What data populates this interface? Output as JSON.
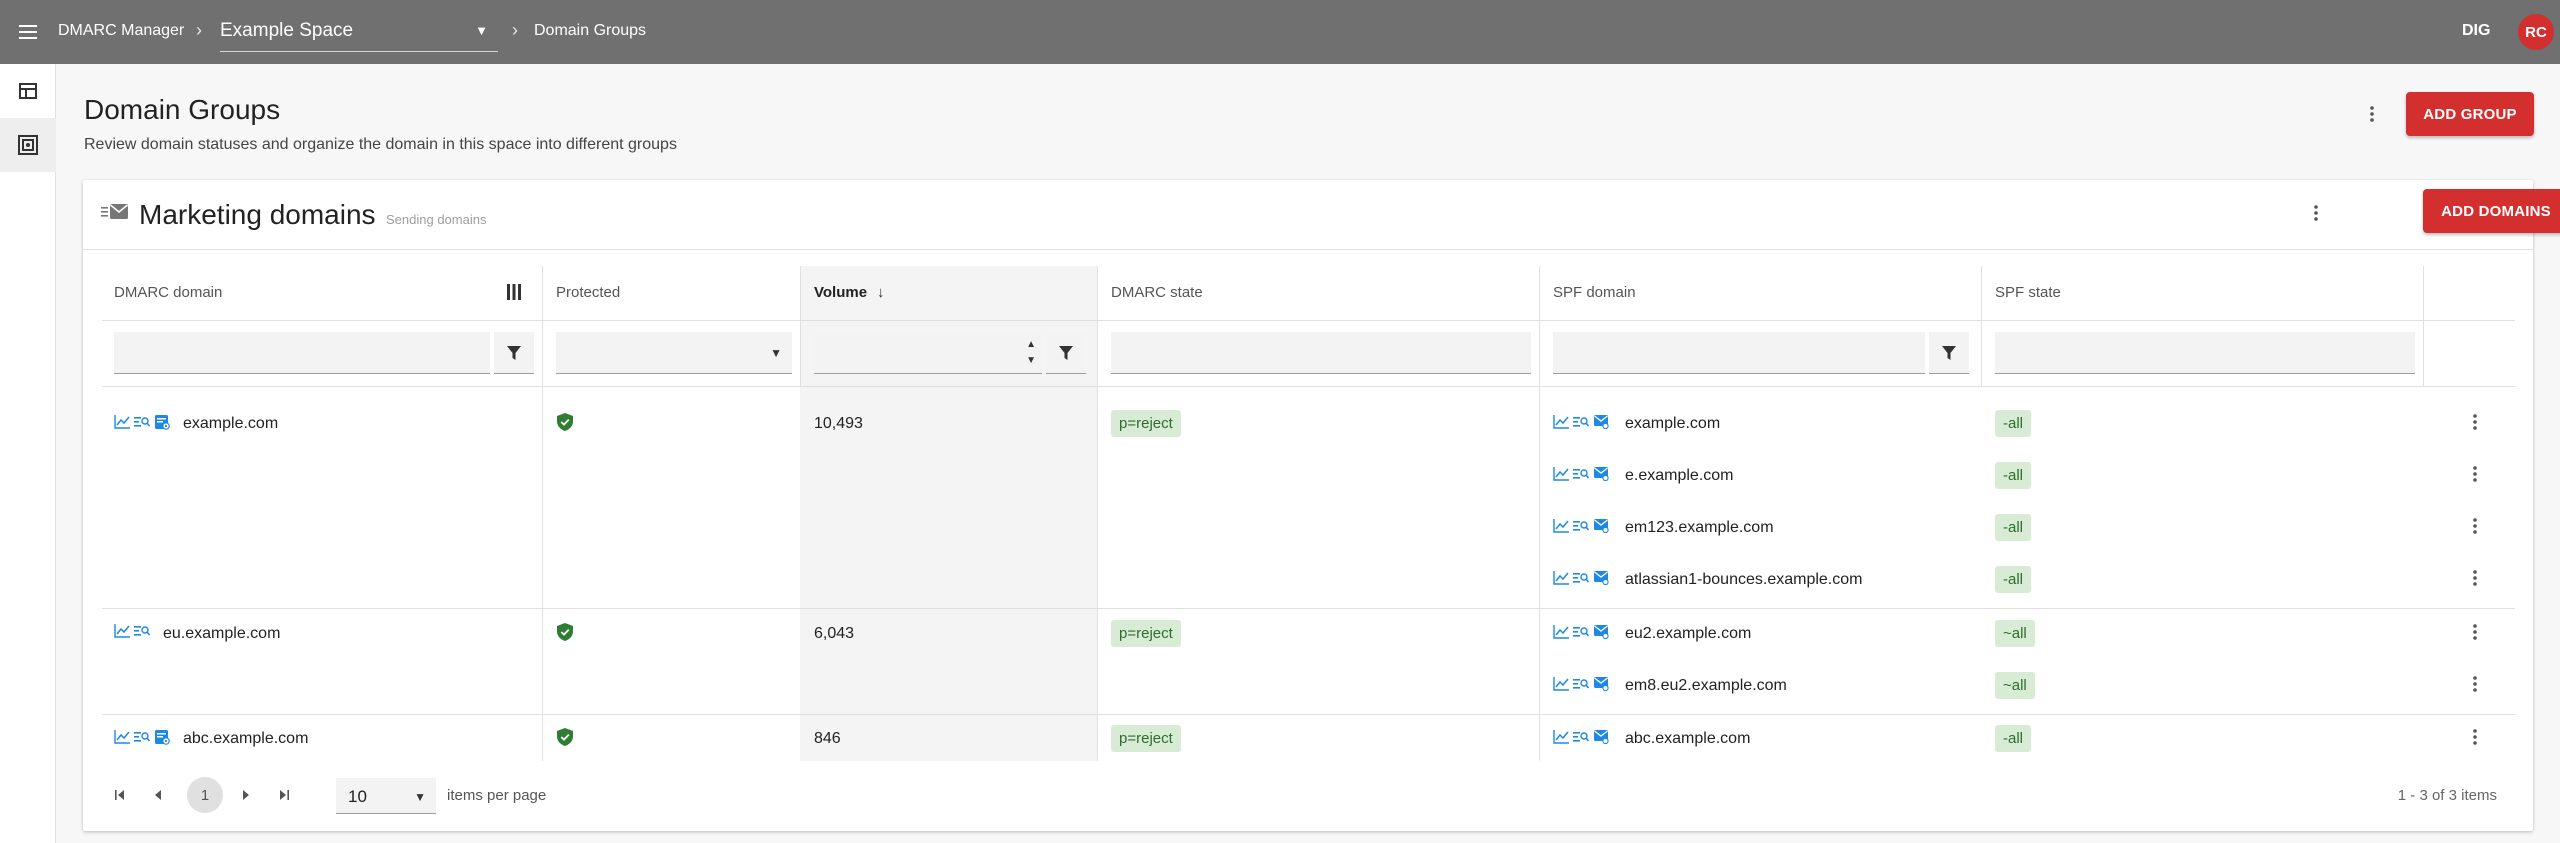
{
  "header": {
    "app_title": "DMARC Manager",
    "space": "Example Space",
    "current_page": "Domain Groups",
    "org_code": "DIG",
    "avatar_initials": "RC",
    "bar_color": "#707070",
    "accent_color": "#d32f2f"
  },
  "rail": {
    "items": [
      {
        "icon": "table-icon",
        "active": false
      },
      {
        "icon": "domain-groups-icon",
        "active": true
      }
    ]
  },
  "page": {
    "title": "Domain Groups",
    "description": "Review domain statuses and organize the domain in this space into different groups",
    "add_group_label": "ADD GROUP"
  },
  "group": {
    "title": "Marketing domains",
    "subtitle": "Sending domains",
    "add_domains_label": "ADD DOMAINS"
  },
  "table": {
    "columns": {
      "dmarc_domain": "DMARC domain",
      "protected": "Protected",
      "volume": "Volume",
      "dmarc_state": "DMARC state",
      "spf_domain": "SPF domain",
      "spf_state": "SPF state"
    },
    "sort": {
      "column": "Volume",
      "direction": "descending"
    },
    "rows": [
      {
        "dmarc_domain": "example.com",
        "protected": true,
        "volume": "10,493",
        "dmarc_state": "p=reject",
        "spf": [
          {
            "domain": "example.com",
            "state": "-all"
          },
          {
            "domain": "e.example.com",
            "state": "-all"
          },
          {
            "domain": "em123.example.com",
            "state": "-all"
          },
          {
            "domain": "atlassian1-bounces.example.com",
            "state": "-all"
          }
        ]
      },
      {
        "dmarc_domain": "eu.example.com",
        "protected": true,
        "volume": "6,043",
        "dmarc_state": "p=reject",
        "spf": [
          {
            "domain": "eu2.example.com",
            "state": "~all"
          },
          {
            "domain": "em8.eu2.example.com",
            "state": "~all"
          }
        ]
      },
      {
        "dmarc_domain": "abc.example.com",
        "protected": true,
        "volume": "846",
        "dmarc_state": "p=reject",
        "spf": [
          {
            "domain": "abc.example.com",
            "state": "-all"
          }
        ]
      }
    ]
  },
  "pager": {
    "current_page": "1",
    "page_size": "10",
    "page_size_label": "items per page",
    "range_label": "1 - 3 of 3 items"
  }
}
